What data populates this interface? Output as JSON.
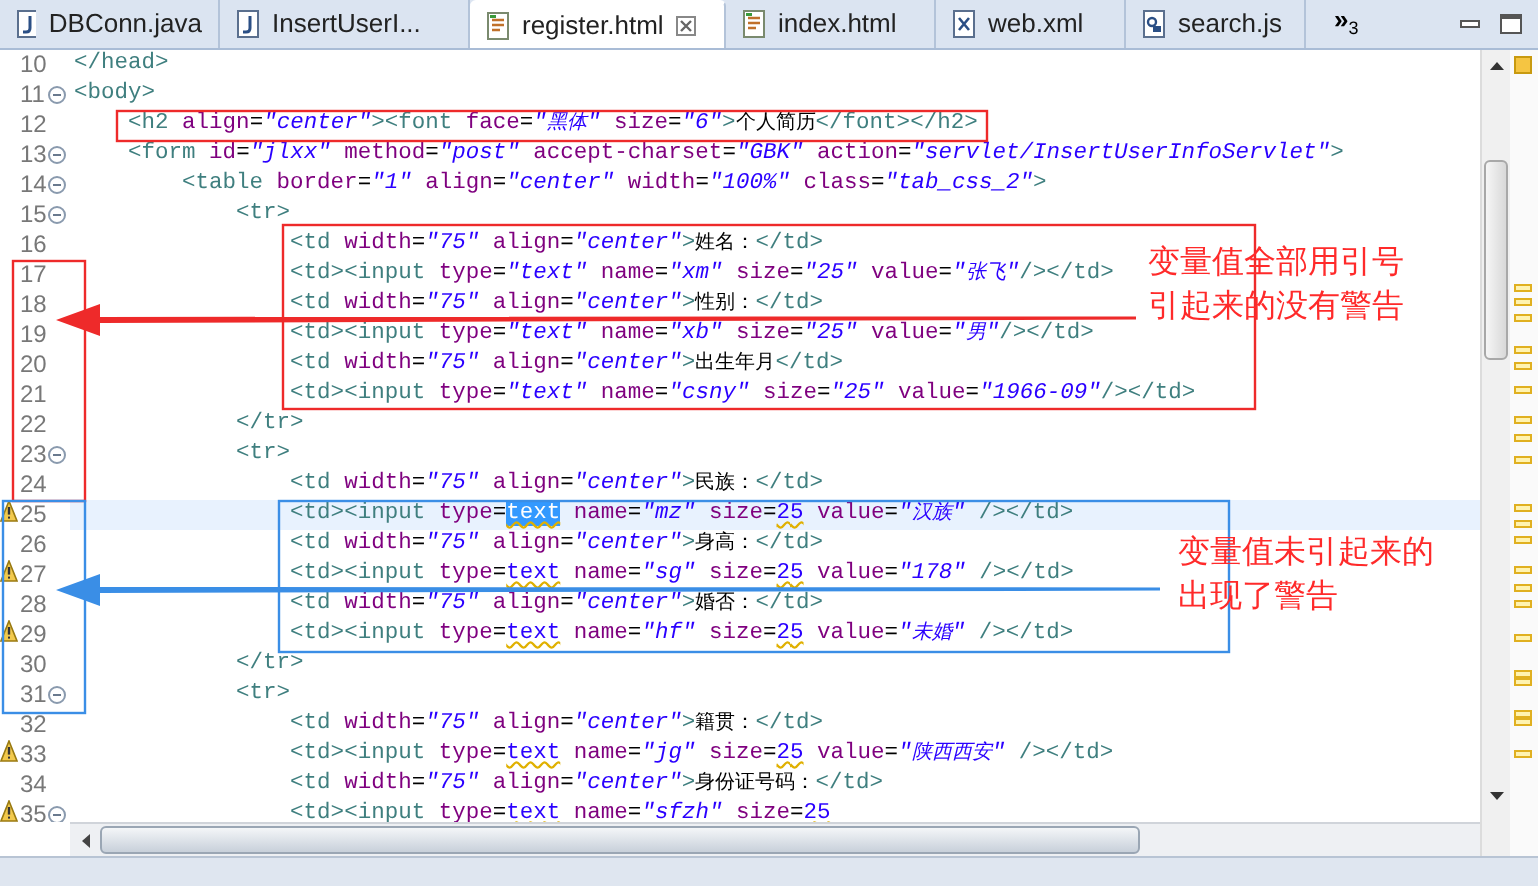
{
  "tabs": [
    {
      "label": "DBConn.java",
      "kind": "java",
      "selected": false
    },
    {
      "label": "InsertUserI...",
      "kind": "java",
      "selected": false
    },
    {
      "label": "register.html",
      "kind": "html",
      "selected": true
    },
    {
      "label": "index.html",
      "kind": "html",
      "selected": false
    },
    {
      "label": "web.xml",
      "kind": "xml",
      "selected": false
    },
    {
      "label": "search.js",
      "kind": "js",
      "selected": false
    }
  ],
  "tab_overflow": {
    "chevron": "»",
    "count": "3"
  },
  "lines": [
    {
      "number": "10",
      "fold": false,
      "warning": false,
      "highlighted": false,
      "code": "</head>"
    },
    {
      "number": "11",
      "fold": true,
      "warning": false,
      "highlighted": false,
      "code": "<body>"
    },
    {
      "number": "12",
      "fold": false,
      "warning": false,
      "highlighted": false,
      "code": "    <h2 align=\"center\"><font face=\"黑体\" size=\"6\">个人简历</font></h2>"
    },
    {
      "number": "13",
      "fold": true,
      "warning": false,
      "highlighted": false,
      "code": "    <form id=\"jlxx\" method=\"post\" accept-charset=\"GBK\" action=\"servlet/InsertUserInfoServlet\">"
    },
    {
      "number": "14",
      "fold": true,
      "warning": false,
      "highlighted": false,
      "code": "        <table border=\"1\" align=\"center\" width=\"100%\" class=\"tab_css_2\">"
    },
    {
      "number": "15",
      "fold": true,
      "warning": false,
      "highlighted": false,
      "code": "            <tr>"
    },
    {
      "number": "16",
      "fold": false,
      "warning": false,
      "highlighted": false,
      "code": "                <td width=\"75\" align=\"center\">姓名：</td>"
    },
    {
      "number": "17",
      "fold": false,
      "warning": false,
      "highlighted": false,
      "code": "                <td><input type=\"text\" name=\"xm\" size=\"25\" value=\"张飞\"/></td>"
    },
    {
      "number": "18",
      "fold": false,
      "warning": false,
      "highlighted": false,
      "code": "                <td width=\"75\" align=\"center\">性别：</td>"
    },
    {
      "number": "19",
      "fold": false,
      "warning": false,
      "highlighted": false,
      "code": "                <td><input type=\"text\" name=\"xb\" size=\"25\" value=\"男\"/></td>"
    },
    {
      "number": "20",
      "fold": false,
      "warning": false,
      "highlighted": false,
      "code": "                <td width=\"75\" align=\"center\">出生年月</td>"
    },
    {
      "number": "21",
      "fold": false,
      "warning": false,
      "highlighted": false,
      "code": "                <td><input type=\"text\" name=\"csny\" size=\"25\" value=\"1966-09\"/></td>"
    },
    {
      "number": "22",
      "fold": false,
      "warning": false,
      "highlighted": false,
      "code": "            </tr>"
    },
    {
      "number": "23",
      "fold": true,
      "warning": false,
      "highlighted": false,
      "code": "            <tr>"
    },
    {
      "number": "24",
      "fold": false,
      "warning": false,
      "highlighted": false,
      "code": "                <td width=\"75\" align=\"center\">民族：</td>"
    },
    {
      "number": "25",
      "fold": false,
      "warning": true,
      "highlighted": true,
      "code": [
        {
          "text": "                <td><input type=",
          "selected": false
        },
        {
          "text": "text",
          "selected": true
        },
        {
          "text": " name=\"mz\" size=25 value=\"汉族\" /></td>",
          "selected": false
        }
      ]
    },
    {
      "number": "26",
      "fold": false,
      "warning": false,
      "highlighted": false,
      "code": "                <td width=\"75\" align=\"center\">身高：</td>"
    },
    {
      "number": "27",
      "fold": false,
      "warning": true,
      "highlighted": false,
      "code": "                <td><input type=text name=\"sg\" size=25 value=\"178\" /></td>"
    },
    {
      "number": "28",
      "fold": false,
      "warning": false,
      "highlighted": false,
      "code": "                <td width=\"75\" align=\"center\">婚否：</td>"
    },
    {
      "number": "29",
      "fold": false,
      "warning": true,
      "highlighted": false,
      "code": "                <td><input type=text name=\"hf\" size=25 value=\"未婚\" /></td>"
    },
    {
      "number": "30",
      "fold": false,
      "warning": false,
      "highlighted": false,
      "code": "            </tr>"
    },
    {
      "number": "31",
      "fold": true,
      "warning": false,
      "highlighted": false,
      "code": "            <tr>"
    },
    {
      "number": "32",
      "fold": false,
      "warning": false,
      "highlighted": false,
      "code": "                <td width=\"75\" align=\"center\">籍贯：</td>"
    },
    {
      "number": "33",
      "fold": false,
      "warning": true,
      "highlighted": false,
      "code": "                <td><input type=text name=\"jg\" size=25 value=\"陕西西安\" /></td>"
    },
    {
      "number": "34",
      "fold": false,
      "warning": false,
      "highlighted": false,
      "code": "                <td width=\"75\" align=\"center\">身份证号码：</td>"
    },
    {
      "number": "35",
      "fold": true,
      "warning": true,
      "highlighted": false,
      "code": "                <td><input type=text name=\"sfzh\" size=25"
    }
  ],
  "callouts": [
    {
      "color": "#ee2a2a",
      "lines": [
        "变量值全部用引号",
        "引起来的没有警告"
      ]
    },
    {
      "color": "#3a8ee6",
      "lines": [
        "变量值未引起来的",
        "出现了警告"
      ]
    }
  ]
}
